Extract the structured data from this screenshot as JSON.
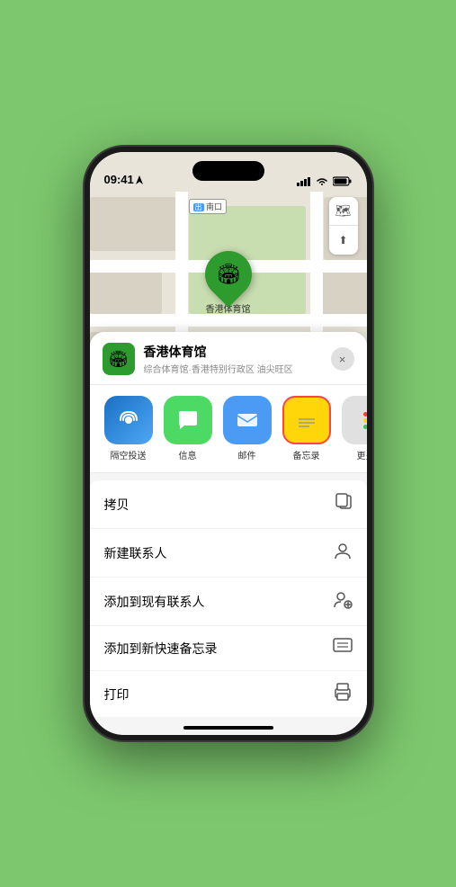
{
  "status": {
    "time": "09:41",
    "location_icon": "▶"
  },
  "map": {
    "label": "南口",
    "pin_label": "香港体育馆"
  },
  "venue": {
    "name": "香港体育馆",
    "subtitle": "综合体育馆·香港特别行政区 油尖旺区",
    "icon": "🏟️"
  },
  "share_items": [
    {
      "id": "airdrop",
      "label": "隔空投送",
      "icon": "📡"
    },
    {
      "id": "messages",
      "label": "信息",
      "icon": "💬"
    },
    {
      "id": "mail",
      "label": "邮件",
      "icon": "✉️"
    },
    {
      "id": "notes",
      "label": "备忘录",
      "icon": "📝"
    }
  ],
  "actions": [
    {
      "id": "copy",
      "label": "拷贝",
      "icon": "⎘"
    },
    {
      "id": "new-contact",
      "label": "新建联系人",
      "icon": "👤"
    },
    {
      "id": "add-contact",
      "label": "添加到现有联系人",
      "icon": "👤"
    },
    {
      "id": "quick-note",
      "label": "添加到新快速备忘录",
      "icon": "📋"
    },
    {
      "id": "print",
      "label": "打印",
      "icon": "🖨️"
    }
  ],
  "buttons": {
    "close_label": "×",
    "map_icon": "🗺️",
    "location_icon": "⬆"
  }
}
